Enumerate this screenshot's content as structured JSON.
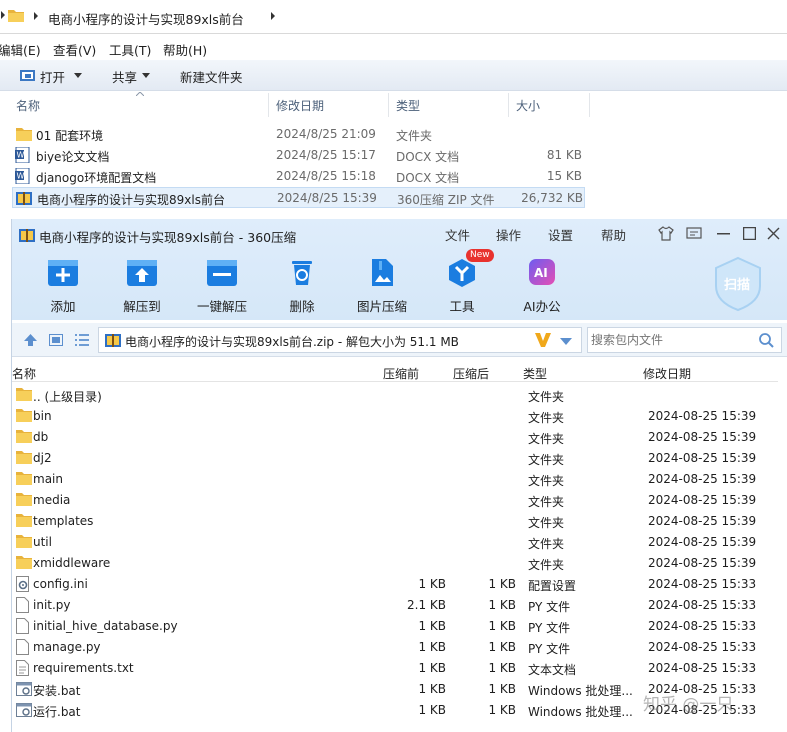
{
  "explorer": {
    "breadcrumb": "电商小程序的设计与实现89xls前台",
    "menu": [
      "编辑(E)",
      "查看(V)",
      "工具(T)",
      "帮助(H)"
    ],
    "toolbar": {
      "open": "打开",
      "share": "共享",
      "new_folder": "新建文件夹"
    },
    "columns": {
      "name": "名称",
      "date": "修改日期",
      "type": "类型",
      "size": "大小"
    },
    "rows": [
      {
        "name": "01 配套环境",
        "date": "2024/8/25 21:09",
        "type": "文件夹",
        "size": "",
        "icon": "folder-icon"
      },
      {
        "name": "biye论文文档",
        "date": "2024/8/25 15:17",
        "type": "DOCX 文档",
        "size": "81 KB",
        "icon": "word-doc-icon"
      },
      {
        "name": "djanogo环境配置文档",
        "date": "2024/8/25 15:18",
        "type": "DOCX 文档",
        "size": "15 KB",
        "icon": "word-doc-icon"
      },
      {
        "name": "电商小程序的设计与实现89xls前台",
        "date": "2024/8/25 15:39",
        "type": "360压缩 ZIP 文件",
        "size": "26,732 KB",
        "icon": "zip-icon"
      }
    ]
  },
  "archiver": {
    "title": "电商小程序的设计与实现89xls前台 - 360压缩",
    "menu": [
      "文件",
      "操作",
      "设置",
      "帮助"
    ],
    "new_badge": "New",
    "scan_label": "扫描",
    "tools": [
      {
        "label": "添加",
        "icon": "add-icon"
      },
      {
        "label": "解压到",
        "icon": "extract-to-icon"
      },
      {
        "label": "一键解压",
        "icon": "one-click-extract-icon"
      },
      {
        "label": "删除",
        "icon": "delete-icon"
      },
      {
        "label": "图片压缩",
        "icon": "image-compress-icon"
      },
      {
        "label": "工具",
        "icon": "tools-icon"
      },
      {
        "label": "AI办公",
        "icon": "ai-office-icon"
      }
    ],
    "path_text": "电商小程序的设计与实现89xls前台.zip - 解包大小为 51.1 MB",
    "search_placeholder": "搜索包内文件",
    "columns": {
      "name": "名称",
      "compressed_before": "压缩前",
      "compressed_after": "压缩后",
      "type": "类型",
      "modified": "修改日期"
    },
    "rows": [
      {
        "name": ".. (上级目录)",
        "before": "",
        "after": "",
        "type": "文件夹",
        "date": "",
        "icon": "folder-icon"
      },
      {
        "name": "bin",
        "before": "",
        "after": "",
        "type": "文件夹",
        "date": "2024-08-25 15:39",
        "icon": "folder-icon"
      },
      {
        "name": "db",
        "before": "",
        "after": "",
        "type": "文件夹",
        "date": "2024-08-25 15:39",
        "icon": "folder-icon"
      },
      {
        "name": "dj2",
        "before": "",
        "after": "",
        "type": "文件夹",
        "date": "2024-08-25 15:39",
        "icon": "folder-icon"
      },
      {
        "name": "main",
        "before": "",
        "after": "",
        "type": "文件夹",
        "date": "2024-08-25 15:39",
        "icon": "folder-icon"
      },
      {
        "name": "media",
        "before": "",
        "after": "",
        "type": "文件夹",
        "date": "2024-08-25 15:39",
        "icon": "folder-icon"
      },
      {
        "name": "templates",
        "before": "",
        "after": "",
        "type": "文件夹",
        "date": "2024-08-25 15:39",
        "icon": "folder-icon"
      },
      {
        "name": "util",
        "before": "",
        "after": "",
        "type": "文件夹",
        "date": "2024-08-25 15:39",
        "icon": "folder-icon"
      },
      {
        "name": "xmiddleware",
        "before": "",
        "after": "",
        "type": "文件夹",
        "date": "2024-08-25 15:39",
        "icon": "folder-icon"
      },
      {
        "name": "config.ini",
        "before": "1 KB",
        "after": "1 KB",
        "type": "配置设置",
        "date": "2024-08-25 15:33",
        "icon": "config-file-icon"
      },
      {
        "name": "init.py",
        "before": "2.1 KB",
        "after": "1 KB",
        "type": "PY 文件",
        "date": "2024-08-25 15:33",
        "icon": "file-icon"
      },
      {
        "name": "initial_hive_database.py",
        "before": "1 KB",
        "after": "1 KB",
        "type": "PY 文件",
        "date": "2024-08-25 15:33",
        "icon": "file-icon"
      },
      {
        "name": "manage.py",
        "before": "1 KB",
        "after": "1 KB",
        "type": "PY 文件",
        "date": "2024-08-25 15:33",
        "icon": "file-icon"
      },
      {
        "name": "requirements.txt",
        "before": "1 KB",
        "after": "1 KB",
        "type": "文本文档",
        "date": "2024-08-25 15:33",
        "icon": "text-file-icon"
      },
      {
        "name": "安装.bat",
        "before": "1 KB",
        "after": "1 KB",
        "type": "Windows 批处理...",
        "date": "2024-08-25 15:33",
        "icon": "batch-file-icon"
      },
      {
        "name": "运行.bat",
        "before": "1 KB",
        "after": "1 KB",
        "type": "Windows 批处理...",
        "date": "2024-08-25 15:33",
        "icon": "batch-file-icon"
      }
    ]
  },
  "watermark": "知乎 @一只"
}
